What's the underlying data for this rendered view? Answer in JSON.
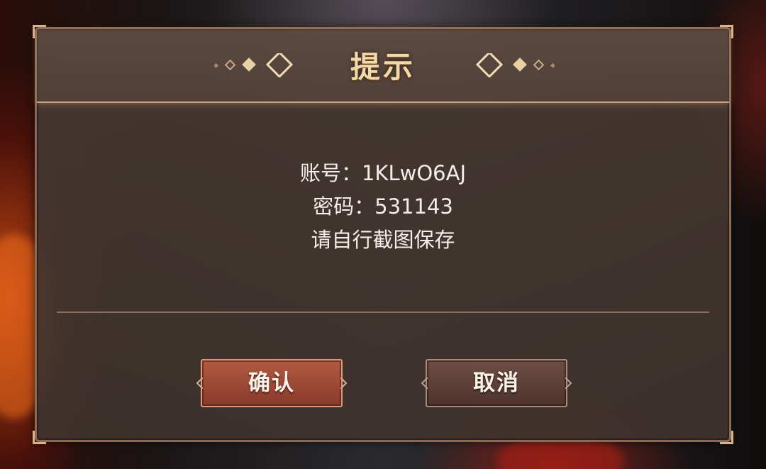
{
  "dialog": {
    "title": "提示",
    "lines": {
      "account": "账号：1KLwO6AJ",
      "password": "密码：531143",
      "hint": "请自行截图保存"
    },
    "buttons": {
      "confirm": "确认",
      "cancel": "取消"
    }
  },
  "colors": {
    "title": "#f3d9a8",
    "accent_border": "#c9a183",
    "confirm_bg": "#a04c37",
    "cancel_bg": "#5e4139"
  },
  "icons": {
    "title_left_ornament": "diamond-ornament-icon",
    "title_right_ornament": "diamond-ornament-icon"
  }
}
